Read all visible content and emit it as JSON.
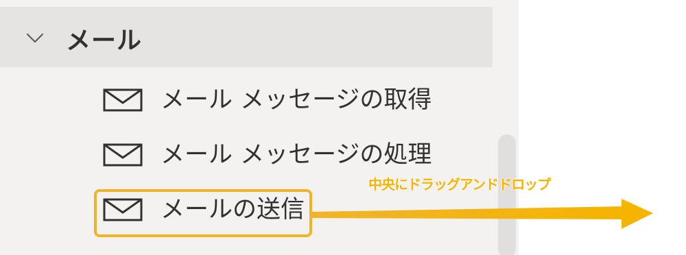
{
  "group": {
    "label": "メール",
    "expanded": true,
    "chevron_icon": "chevron-down-icon"
  },
  "actions": [
    {
      "label": "メール メッセージの取得",
      "icon": "mail-icon"
    },
    {
      "label": "メール メッセージの処理",
      "icon": "mail-icon"
    },
    {
      "label": "メールの送信",
      "icon": "mail-icon",
      "highlighted": true
    }
  ],
  "annotation": {
    "text": "中央にドラッグアンドドロップ",
    "color": "#f5b400"
  },
  "colors": {
    "panel_background": "#f3f2f1",
    "header_background": "#e6e4e3",
    "highlight": "#f0b429",
    "text": "#323130"
  }
}
